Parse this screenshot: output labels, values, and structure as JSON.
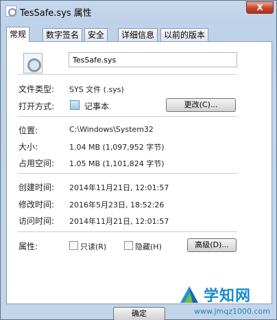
{
  "window": {
    "title": "TesSafe.sys 属性",
    "close_label": "X"
  },
  "tabs": [
    {
      "label": "常规",
      "active": true
    },
    {
      "label": "数字签名",
      "active": false
    },
    {
      "label": "安全",
      "active": false
    },
    {
      "label": "详细信息",
      "active": false
    },
    {
      "label": "以前的版本",
      "active": false
    }
  ],
  "general": {
    "file_name": "TesSafe.sys",
    "file_type_label": "文件类型:",
    "file_type_value": "SYS 文件 (.sys)",
    "open_with_label": "打开方式:",
    "open_with_value": "记事本",
    "change_button": "更改(C)...",
    "location_label": "位置:",
    "location_value": "C:\\Windows\\System32",
    "size_label": "大小:",
    "size_value": "1.04 MB (1,097,952 字节)",
    "size_on_disk_label": "占用空间:",
    "size_on_disk_value": "1.05 MB (1,101,824 字节)",
    "created_label": "创建时间:",
    "created_value": "2014年11月21日, 12:01:57",
    "modified_label": "修改时间:",
    "modified_value": "2016年5月23日, 18:52:26",
    "accessed_label": "访问时间:",
    "accessed_value": "2014年11月21日, 12:01:57",
    "attributes_label": "属性:",
    "readonly_label": "只读(R)",
    "readonly_checked": false,
    "hidden_label": "隐藏(H)",
    "hidden_checked": false,
    "advanced_button": "高级(D)..."
  },
  "footer": {
    "ok_button": "确定"
  },
  "watermark": {
    "text": "学知网",
    "url": "www.jmqz1000.com"
  }
}
